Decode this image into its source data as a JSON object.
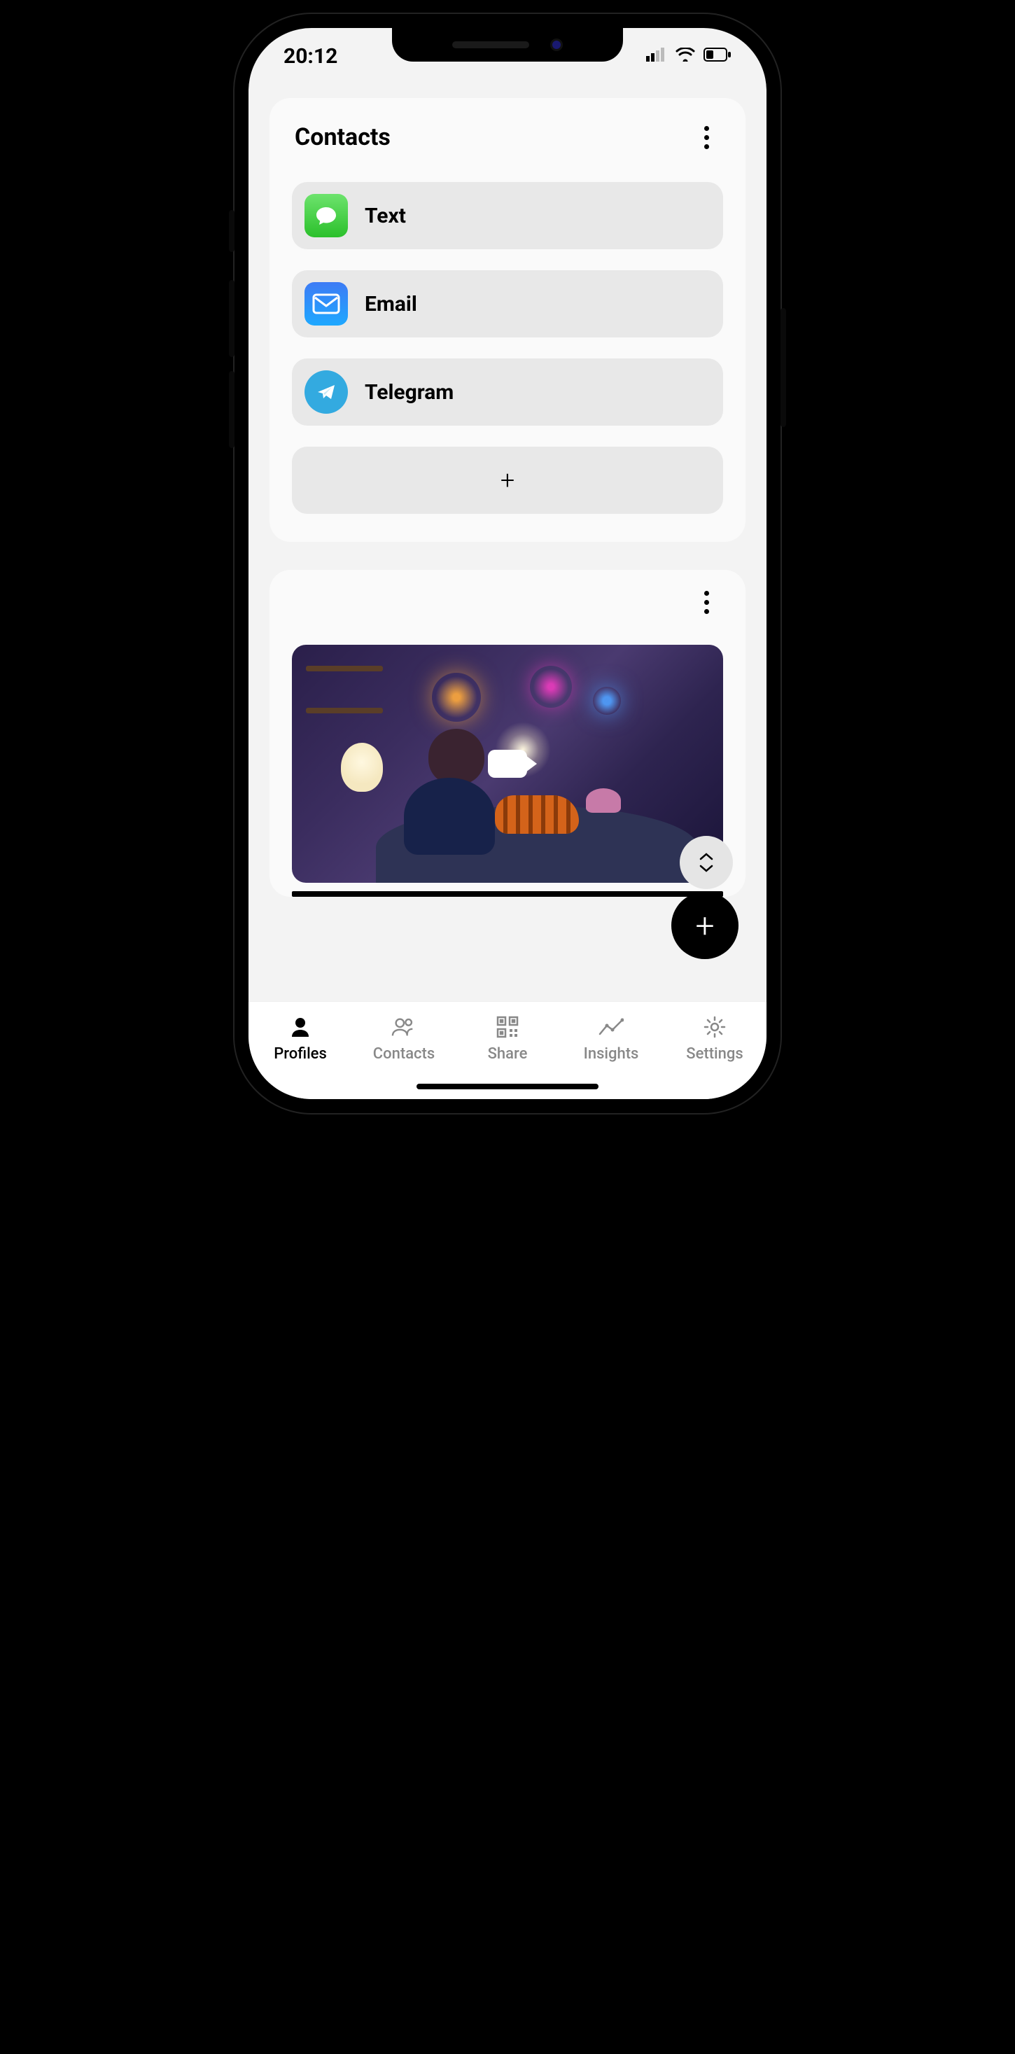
{
  "status": {
    "time": "20:12"
  },
  "contacts_card": {
    "title": "Contacts",
    "items": [
      {
        "label": "Text",
        "icon": "messages-icon"
      },
      {
        "label": "Email",
        "icon": "mail-icon"
      },
      {
        "label": "Telegram",
        "icon": "telegram-icon"
      }
    ],
    "add_label": "+"
  },
  "tabs": [
    {
      "label": "Profiles",
      "active": true
    },
    {
      "label": "Contacts",
      "active": false
    },
    {
      "label": "Share",
      "active": false
    },
    {
      "label": "Insights",
      "active": false
    },
    {
      "label": "Settings",
      "active": false
    }
  ],
  "fab": {
    "add": "+"
  }
}
